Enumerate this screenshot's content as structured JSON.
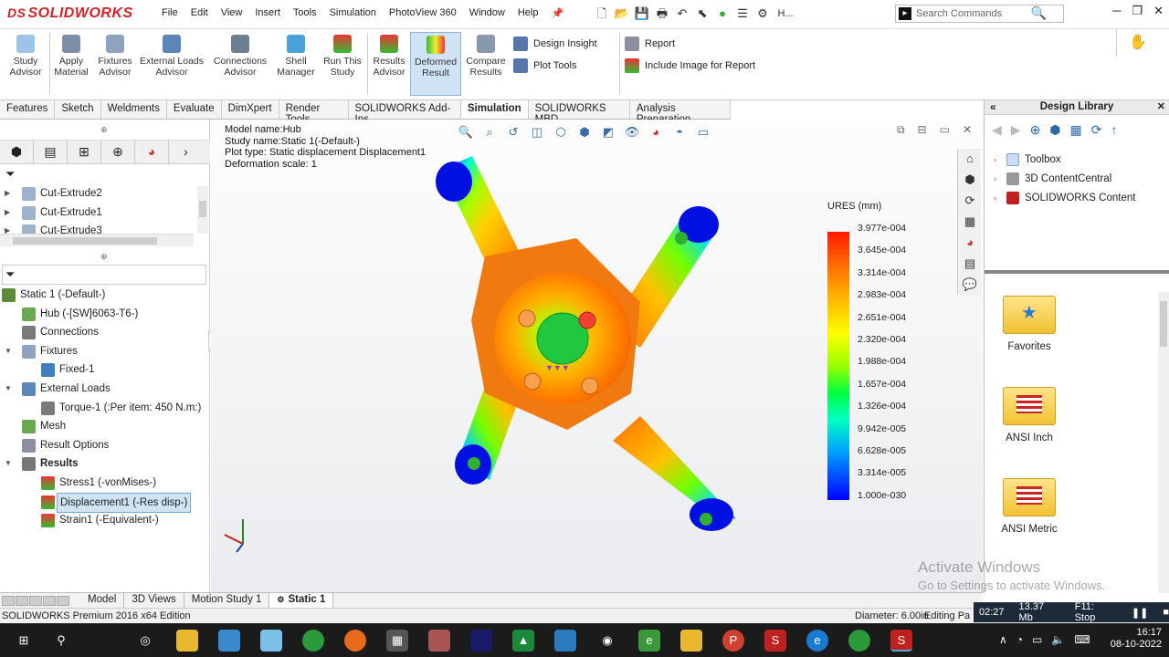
{
  "app": {
    "brand_ds": "DS",
    "brand_name": "SOLIDWORKS"
  },
  "menu": [
    "File",
    "Edit",
    "View",
    "Insert",
    "Tools",
    "Simulation",
    "PhotoView 360",
    "Window",
    "Help"
  ],
  "search": {
    "placeholder": "Search Commands",
    "h_label": "H..."
  },
  "ribbon": {
    "study_advisor": "Study Advisor",
    "apply_material": "Apply Material",
    "fixtures_advisor": "Fixtures Advisor",
    "external_loads_advisor": "External Loads Advisor",
    "connections_advisor": "Connections Advisor",
    "shell_manager": "Shell Manager",
    "run_this_study": "Run This Study",
    "results_advisor": "Results Advisor",
    "deformed_result": "Deformed Result",
    "compare_results": "Compare Results",
    "design_insight": "Design Insight",
    "plot_tools": "Plot Tools",
    "report": "Report",
    "include_image": "Include Image for Report"
  },
  "command_tabs": [
    "Features",
    "Sketch",
    "Weldments",
    "Evaluate",
    "DimXpert",
    "Render Tools",
    "SOLIDWORKS Add-Ins",
    "Simulation",
    "SOLIDWORKS MBD",
    "Analysis Preparation"
  ],
  "active_command_tab": "Simulation",
  "feature_tree": [
    "Cut-Extrude2",
    "Cut-Extrude1",
    "Cut-Extrude3"
  ],
  "study_tree": {
    "study": "Static 1 (-Default-)",
    "hub": "Hub (-[SW]6063-T6-)",
    "connections": "Connections",
    "fixtures": "Fixtures",
    "fixed": "Fixed-1",
    "external_loads": "External Loads",
    "torque": "Torque-1 (:Per item: 450 N.m:)",
    "mesh": "Mesh",
    "result_options": "Result Options",
    "results": "Results",
    "stress": "Stress1 (-vonMises-)",
    "displacement": "Displacement1 (-Res disp-)",
    "strain": "Strain1 (-Equivalent-)"
  },
  "plot_info": {
    "model_name": "Model name:Hub",
    "study_name": "Study name:Static 1(-Default-)",
    "plot_type": "Plot type: Static displacement Displacement1",
    "deformation_scale": "Deformation scale: 1"
  },
  "legend": {
    "title": "URES (mm)",
    "values": [
      "3.977e-004",
      "3.645e-004",
      "3.314e-004",
      "2.983e-004",
      "2.651e-004",
      "2.320e-004",
      "1.988e-004",
      "1.657e-004",
      "1.326e-004",
      "9.942e-005",
      "6.628e-005",
      "3.314e-005",
      "1.000e-030"
    ]
  },
  "design_library": {
    "title": "Design Library",
    "tree": [
      "Toolbox",
      "3D ContentCentral",
      "SOLIDWORKS Content"
    ],
    "folders": [
      "Favorites",
      "ANSI Inch",
      "ANSI Metric"
    ]
  },
  "bottom_tabs": [
    "Model",
    "3D Views",
    "Motion Study 1",
    "Static 1"
  ],
  "active_bottom_tab": "Static 1",
  "status": {
    "edition": "SOLIDWORKS Premium 2016 x64 Edition",
    "diameter": "Diameter: 6.00in",
    "editing": "Editing Pa"
  },
  "recorder": {
    "time": "02:27",
    "size": "13.37 Mb",
    "stop": "F11: Stop"
  },
  "watermark": {
    "line1": "Activate Windows",
    "line2": "Go to Settings to activate Windows."
  },
  "clock": {
    "time": "16:17",
    "date": "08-10-2022"
  }
}
